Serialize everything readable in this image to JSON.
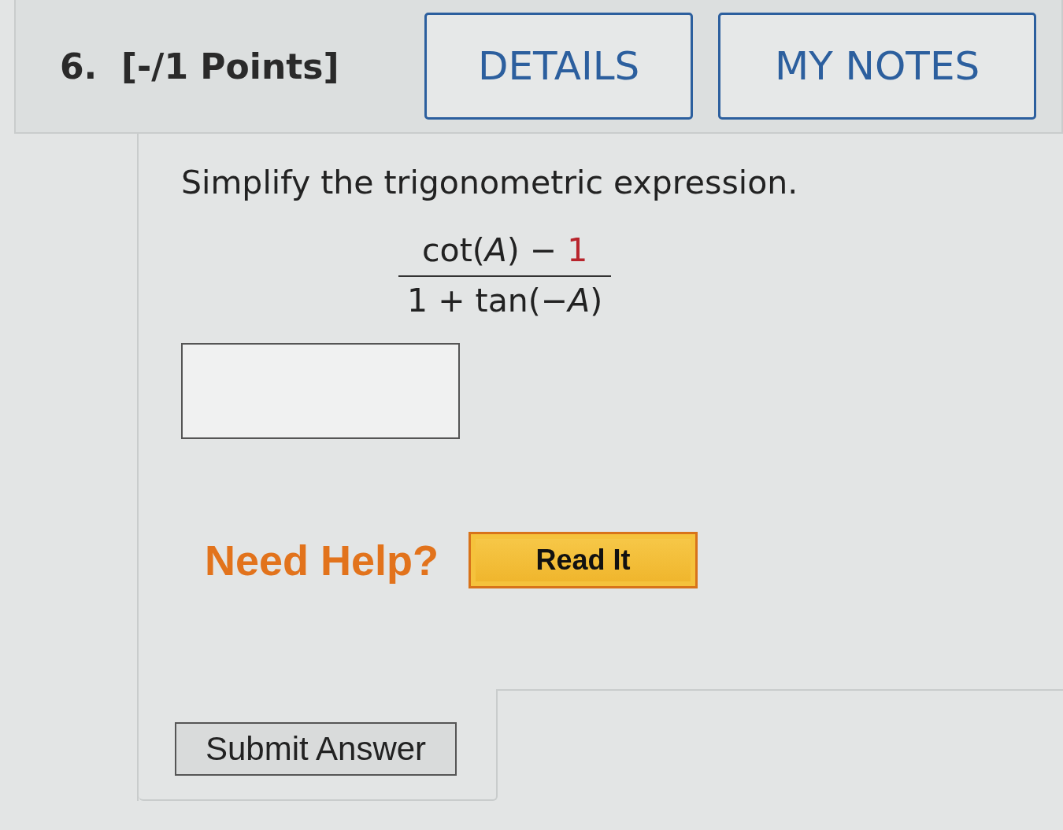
{
  "question": {
    "number": "6.",
    "points": "[-/1 Points]"
  },
  "header_buttons": [
    {
      "label": "DETAILS"
    },
    {
      "label": "MY NOTES"
    }
  ],
  "prompt": "Simplify the trigonometric expression.",
  "expression": {
    "numerator": [
      {
        "text": "cot(*A*) − "
      },
      {
        "text": "1",
        "color": "#b8242c"
      }
    ],
    "denominator": [
      {
        "text": "1 + tan(−*A*)"
      }
    ]
  },
  "help": {
    "label": "Need Help?",
    "button": "Read It"
  },
  "submit_button": "Submit Answer"
}
